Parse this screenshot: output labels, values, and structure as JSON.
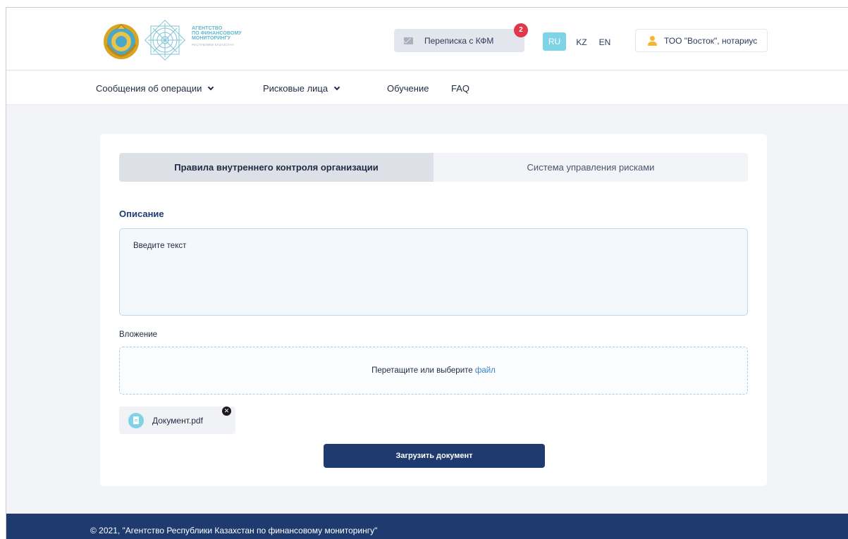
{
  "header": {
    "agency_name_lines": [
      "АГЕНТСТВО",
      "ПО ФИНАНСОВОМУ",
      "МОНИТОРИНГУ"
    ],
    "agency_subtitle": "РЕСПУБЛИКИ КАЗАХСТАН",
    "kfm_button_label": "Переписка с КФМ",
    "notifications_count": "2",
    "languages": [
      "RU",
      "KZ",
      "EN"
    ],
    "active_language": "RU",
    "user_label": "ТОО \"Восток\", нотариус",
    "colors": {
      "accent": "#7fd3e6",
      "badge": "#e0374b",
      "user_icon": "#f5b531"
    }
  },
  "nav": {
    "items": [
      {
        "label": "Сообщения об операции",
        "has_dropdown": true
      },
      {
        "label": "Рисковые лица",
        "has_dropdown": true
      },
      {
        "label": "Обучение",
        "has_dropdown": false
      },
      {
        "label": "FAQ",
        "has_dropdown": false
      }
    ]
  },
  "main": {
    "tabs": [
      {
        "label": "Правила внутреннего контроля организации",
        "active": true
      },
      {
        "label": "Система управления рисками",
        "active": false
      }
    ],
    "description_title": "Описание",
    "description_placeholder": "Введите текст",
    "attachment_label": "Вложение",
    "dropzone_text": "Перетащите или выберите",
    "dropzone_link": "файл",
    "attached_file": "Документ.pdf",
    "upload_button": "Загрузить документ"
  },
  "footer": {
    "copyright": "© 2021, \"Агентство Республики Казахстан по финансовому мониторингу\""
  },
  "theme": {
    "primary": "#1f3a6e",
    "section_title": "#1f3a74",
    "link": "#3a87c8"
  }
}
